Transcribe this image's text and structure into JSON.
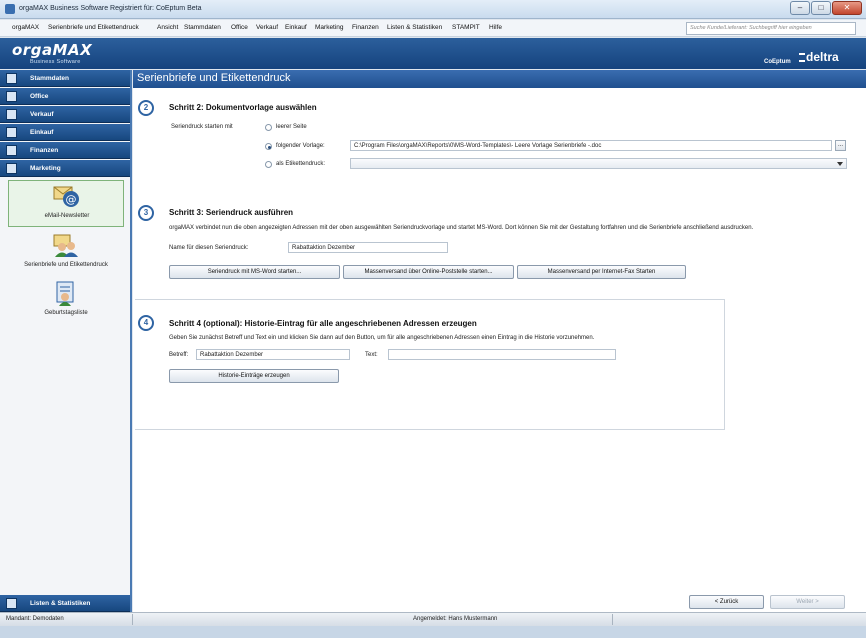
{
  "window": {
    "title": "orgaMAX Business Software Registriert für: CoEptum Beta",
    "minimize_icon": "minimize-icon",
    "maximize_icon": "maximize-icon",
    "close_icon": "close-icon"
  },
  "menu": [
    "orgaMAX",
    "Serienbriefe und Etikettendruck",
    "Ansicht",
    "Stammdaten",
    "Office",
    "Verkauf",
    "Einkauf",
    "Marketing",
    "Finanzen",
    "Listen & Statistiken",
    "STAMPIT",
    "Hilfe"
  ],
  "search": {
    "placeholder": "Suche Kunde/Lieferant: Suchbegriff hier eingeben"
  },
  "brand": {
    "logo": "orgaMAX",
    "subtitle": "Business Software",
    "user": "CoEptum",
    "partner": "deltra"
  },
  "sidebar": {
    "nav": [
      {
        "label": "Stammdaten",
        "icon": "stammdaten-icon"
      },
      {
        "label": "Office",
        "icon": "office-icon"
      },
      {
        "label": "Verkauf",
        "icon": "verkauf-icon"
      },
      {
        "label": "Einkauf",
        "icon": "einkauf-icon"
      },
      {
        "label": "Finanzen",
        "icon": "finanzen-icon"
      },
      {
        "label": "Marketing",
        "icon": "marketing-icon"
      }
    ],
    "modules": [
      {
        "label": "eMail-Newsletter",
        "icon": "email-newsletter-icon",
        "selected": true
      },
      {
        "label": "Serienbriefe und Etikettendruck",
        "icon": "serienbriefe-icon",
        "selected": false
      },
      {
        "label": "Geburtstagsliste",
        "icon": "birthday-list-icon",
        "selected": false
      }
    ],
    "bottom_nav": {
      "label": "Listen & Statistiken",
      "icon": "statistics-icon"
    }
  },
  "page": {
    "title": "Serienbriefe und Etikettendruck"
  },
  "step2": {
    "number": "2",
    "heading": "Schritt 2: Dokumentvorlage auswählen",
    "start_label": "Seriendruck starten mit",
    "options": [
      {
        "label": "leerer Seite",
        "checked": false
      },
      {
        "label": "folgender Vorlage:",
        "checked": true
      },
      {
        "label": "als Etikettendruck:",
        "checked": false
      }
    ],
    "template_path": "C:\\Program Files\\orgaMAX\\Reports\\0\\MS-Word-Templates\\- Leere Vorlage Serienbriefe -.doc",
    "browse_label": "..."
  },
  "step3": {
    "number": "3",
    "heading": "Schritt 3: Seriendruck ausführen",
    "description": "orgaMAX verbindet nun die oben angezeigten Adressen mit der oben ausgewählten Seriendruckvorlage und startet MS-Word. Dort können Sie mit der Gestaltung fortfahren und die Serienbriefe anschließend ausdrucken.",
    "name_label": "Name für diesen Seriendruck:",
    "name_value": "Rabattaktion Dezember",
    "buttons": [
      "Seriendruck mit MS-Word starten...",
      "Massenversand über Online-Poststelle starten...",
      "Massenversand per Internet-Fax Starten"
    ]
  },
  "step4": {
    "number": "4",
    "heading": "Schritt 4 (optional): Historie-Eintrag für alle angeschriebenen Adressen erzeugen",
    "description": "Geben Sie zunächst Betreff und Text ein und klicken Sie dann auf den Button, um für alle angeschriebenen Adressen einen Eintrag in die Historie vorzunehmen.",
    "subject_label": "Betreff:",
    "subject_value": "Rabattaktion Dezember",
    "text_label": "Text:",
    "text_value": "",
    "button": "Historie-Einträge erzeugen"
  },
  "wizard": {
    "back": "< Zurück",
    "next": "Weiter >"
  },
  "status": {
    "mandant": "Mandant: Demodaten",
    "user": "Angemeldet: Hans Mustermann"
  },
  "colors": {
    "nav_blue": "#1f4f8e",
    "accent": "#2f64a3",
    "selection_green": "#7fb37a"
  }
}
